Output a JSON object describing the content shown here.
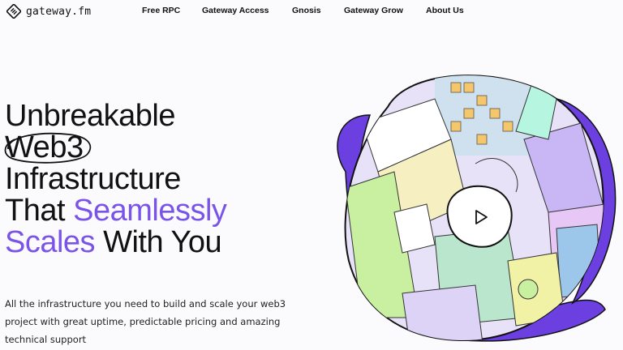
{
  "brand": {
    "name": "gateway.fm",
    "icon": "gateway-logo-icon"
  },
  "nav": {
    "items": [
      {
        "label": "Free RPC"
      },
      {
        "label": "Gateway Access"
      },
      {
        "label": "Gnosis"
      },
      {
        "label": "Gateway Grow"
      },
      {
        "label": "About Us"
      }
    ]
  },
  "hero": {
    "title": {
      "line1": "Unbreakable",
      "line2_circled": "Web3",
      "line3": "Infrastructure",
      "line4_plain": "That ",
      "line4_accent": "Seamlessly",
      "line5_accent": "Scales",
      "line5_plain": " With You"
    },
    "description": "All the infrastructure you need to build and scale your web3 project with great uptime, predictable pricing and amazing technical support",
    "video": {
      "play_icon": "play-icon"
    }
  },
  "colors": {
    "accent": "#7a54e8",
    "ring": "#6b3fe0",
    "text": "#111111",
    "background": "#fbfafc"
  }
}
